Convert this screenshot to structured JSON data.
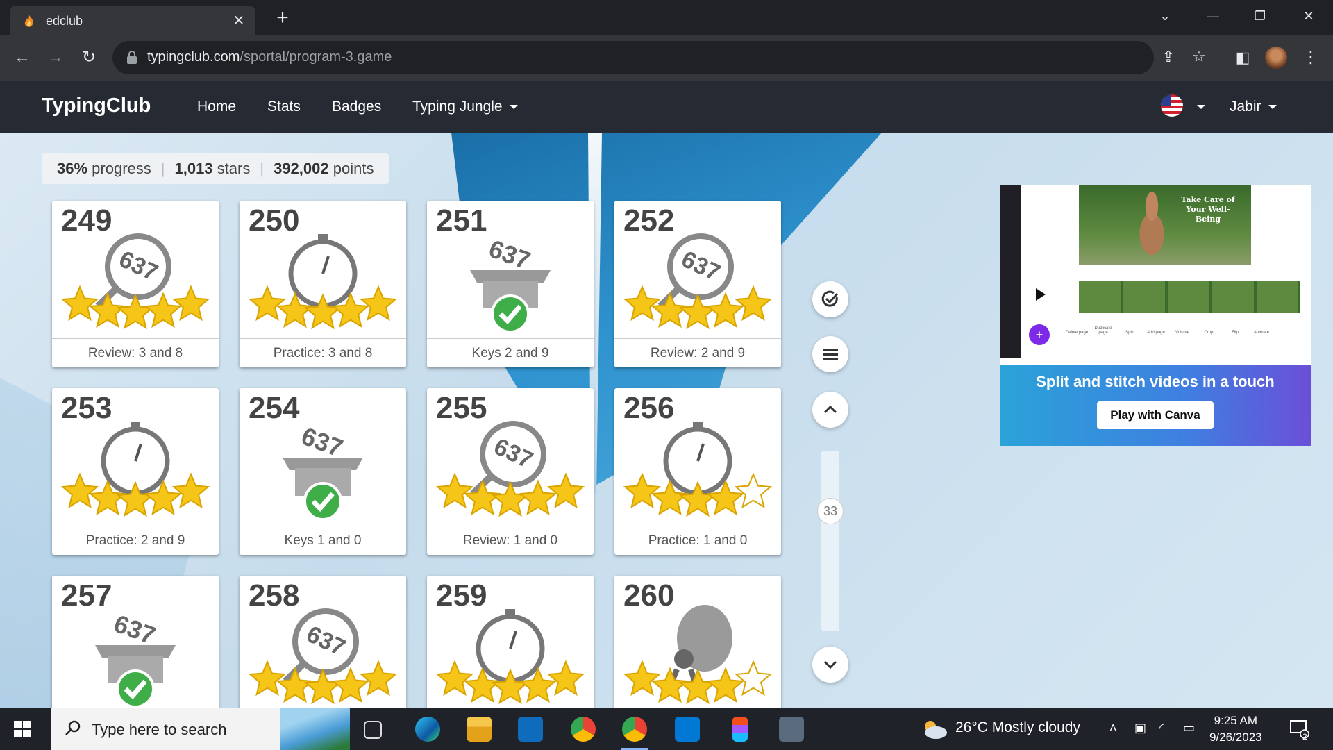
{
  "browser": {
    "tab_title": "edclub",
    "url_host": "typingclub.com",
    "url_path": "/sportal/program-3.game"
  },
  "site": {
    "brand": "TypingClub",
    "nav": [
      "Home",
      "Stats",
      "Badges",
      "Typing Jungle"
    ],
    "user": "Jabir"
  },
  "progress": {
    "percent": "36%",
    "percent_label": "progress",
    "stars": "1,013",
    "stars_label": "stars",
    "points": "392,002",
    "points_label": "points"
  },
  "lessons": [
    {
      "num": "249",
      "label": "Review: 3 and 8",
      "kind": "review",
      "stars": 5,
      "done": false
    },
    {
      "num": "250",
      "label": "Practice: 3 and 8",
      "kind": "practice",
      "stars": 5,
      "done": false
    },
    {
      "num": "251",
      "label": "Keys 2 and 9",
      "kind": "keys",
      "stars": 0,
      "done": true
    },
    {
      "num": "252",
      "label": "Review: 2 and 9",
      "kind": "review",
      "stars": 5,
      "done": false
    },
    {
      "num": "253",
      "label": "Practice: 2 and 9",
      "kind": "practice",
      "stars": 5,
      "done": false
    },
    {
      "num": "254",
      "label": "Keys 1 and 0",
      "kind": "keys",
      "stars": 0,
      "done": true
    },
    {
      "num": "255",
      "label": "Review: 1 and 0",
      "kind": "review",
      "stars": 5,
      "done": false
    },
    {
      "num": "256",
      "label": "Practice: 1 and 0",
      "kind": "practice",
      "stars": 4,
      "done": false
    },
    {
      "num": "257",
      "label": "",
      "kind": "keys",
      "stars": 0,
      "done": true
    },
    {
      "num": "258",
      "label": "",
      "kind": "review",
      "stars": 5,
      "done": false
    },
    {
      "num": "259",
      "label": "",
      "kind": "practice",
      "stars": 5,
      "done": false
    },
    {
      "num": "260",
      "label": "",
      "kind": "game",
      "stars": 4,
      "done": false
    }
  ],
  "scroll_indicator": "33",
  "ad": {
    "photo_text": "Take Care of Your Well-Being",
    "tools": [
      "Delete page",
      "Duplicate page",
      "Split",
      "Add page",
      "Volume",
      "Crop",
      "Flip",
      "Animate"
    ],
    "headline": "Split and stitch videos in a touch",
    "cta": "Play with Canva"
  },
  "taskbar": {
    "search_placeholder": "Type here to search",
    "weather": "26°C  Mostly cloudy",
    "time": "9:25 AM",
    "date": "9/26/2023",
    "notifications": "2"
  },
  "colors": {
    "navbar": "#252a33",
    "star": "#f5c518",
    "check": "#3fae49"
  }
}
